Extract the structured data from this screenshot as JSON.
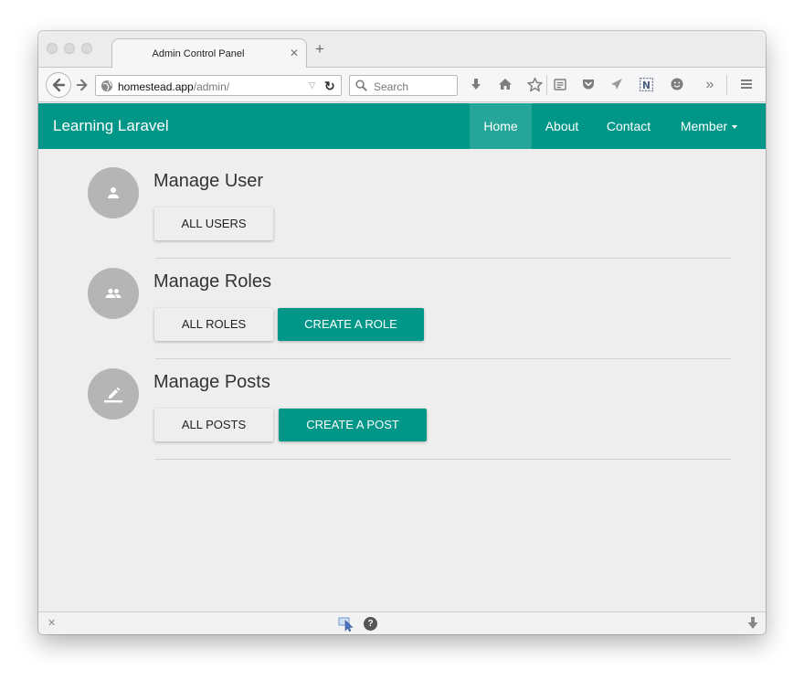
{
  "browser": {
    "tab_title": "Admin Control Panel",
    "tab_close": "✕",
    "new_tab": "+",
    "url_host": "homestead.app",
    "url_path": "/admin/",
    "search_placeholder": "Search",
    "overflow": "»",
    "help": "?"
  },
  "navbar": {
    "brand": "Learning Laravel",
    "items": [
      {
        "label": "Home",
        "active": true
      },
      {
        "label": "About"
      },
      {
        "label": "Contact"
      },
      {
        "label": "Member",
        "dropdown": true
      }
    ]
  },
  "sections": [
    {
      "title": "Manage User",
      "icon": "person-icon",
      "buttons": [
        {
          "label": "All Users"
        }
      ]
    },
    {
      "title": "Manage Roles",
      "icon": "group-icon",
      "buttons": [
        {
          "label": "All Roles"
        },
        {
          "label": "Create a Role"
        }
      ]
    },
    {
      "title": "Manage Posts",
      "icon": "edit-icon",
      "buttons": [
        {
          "label": "All Posts"
        },
        {
          "label": "Create a Post"
        }
      ]
    }
  ],
  "colors": {
    "primary": "#009688",
    "primary_active": "#26a69a",
    "page_bg": "#eeeeee",
    "avatar": "#b5b5b5"
  }
}
